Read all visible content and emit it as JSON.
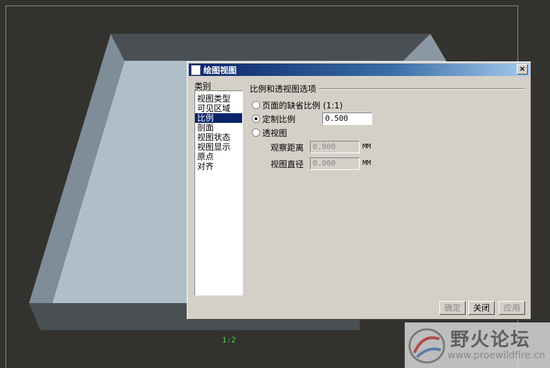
{
  "viewport": {
    "scale_label": "1:2",
    "colors": {
      "background": "#33322f",
      "model_top": "#4a4f54",
      "model_light": "#b0bec8",
      "model_side": "#8a98a4",
      "scale_text": "#48d848"
    }
  },
  "watermark": {
    "name": "野火论坛",
    "url": "www.proewildfire.cn"
  },
  "dialog": {
    "title": "绘图视图",
    "close_glyph": "×",
    "category_label": "类别",
    "categories": [
      "视图类型",
      "可见区域",
      "比例",
      "剖面",
      "视图状态",
      "视图显示",
      "原点",
      "对齐"
    ],
    "selected_category": "比例",
    "group_title": "比例和透视图选项",
    "options": {
      "page_default": "页面的缺省比例 (1:1)",
      "custom": "定制比例",
      "perspective": "透视图"
    },
    "custom_scale_value": "0.500",
    "observe_distance": {
      "label": "观察距离",
      "value": "0.000",
      "unit": "MM"
    },
    "view_diameter": {
      "label": "视图直径",
      "value": "0.000",
      "unit": "MM"
    },
    "buttons": {
      "ok": "确定",
      "close": "关闭",
      "apply": "应用"
    },
    "colors": {
      "titlebar_start": "#0a246a",
      "titlebar_end": "#a6caf0",
      "selection": "#0a246a",
      "face": "#d4d0c8"
    }
  }
}
